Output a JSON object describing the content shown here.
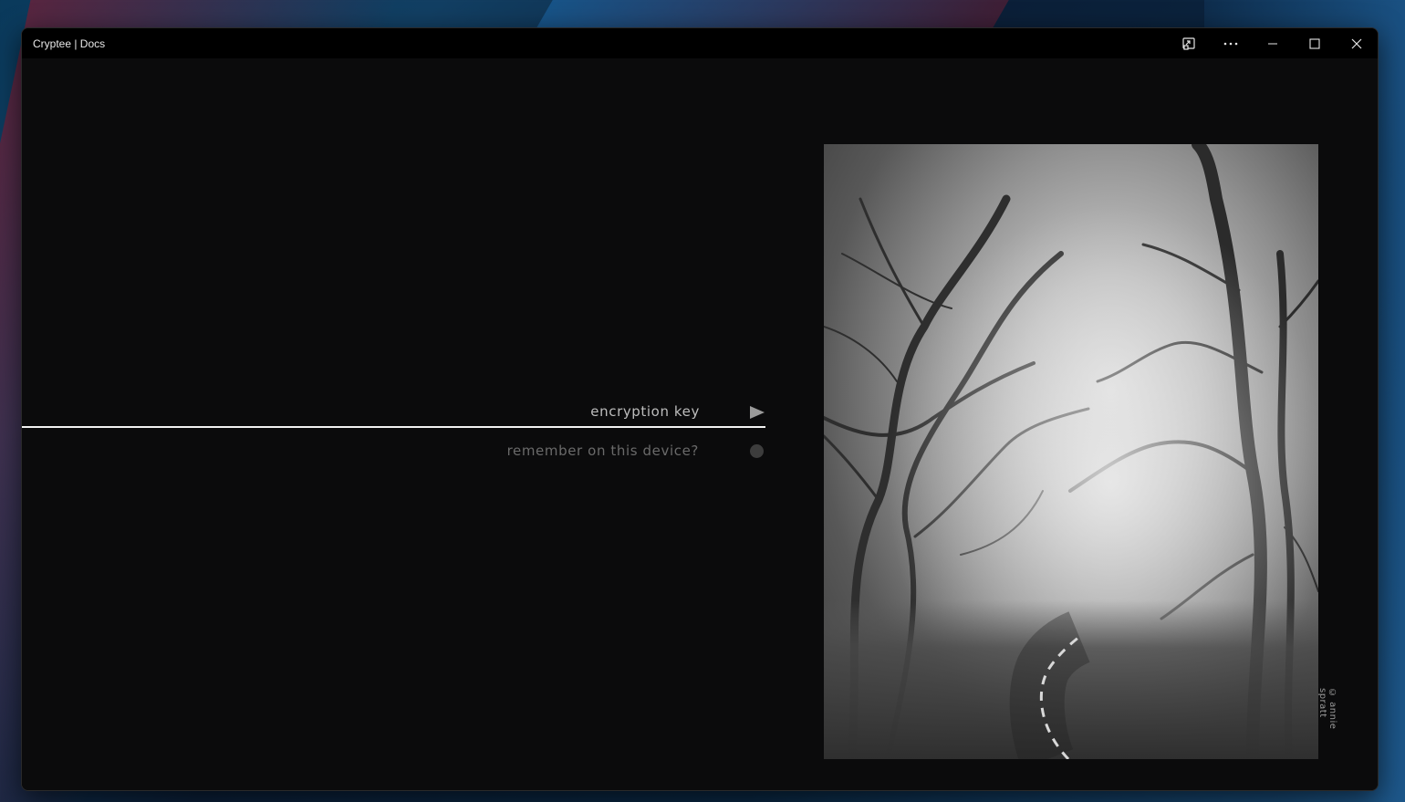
{
  "window": {
    "title": "Cryptee | Docs"
  },
  "titlebar": {
    "buttons": [
      {
        "icon": "cast-icon",
        "label": "Cast"
      },
      {
        "icon": "more-icon",
        "label": "More options"
      },
      {
        "icon": "minimize-icon",
        "label": "Minimize"
      },
      {
        "icon": "maximize-icon",
        "label": "Maximize"
      },
      {
        "icon": "close-icon",
        "label": "Close"
      }
    ]
  },
  "login": {
    "key_label": "encryption key",
    "key_value": "",
    "remember_label": "remember on this device?",
    "remember_checked": false,
    "submit_icon": "play-arrow-icon"
  },
  "photo": {
    "credit": "© annie spratt",
    "description_icon": "foggy-forest-road-image"
  },
  "colors": {
    "background": "#0b0b0c",
    "titlebar": "#000000",
    "underline": "#f2f2f2",
    "label": "#bdbdbd",
    "muted": "#6a6a6a"
  }
}
